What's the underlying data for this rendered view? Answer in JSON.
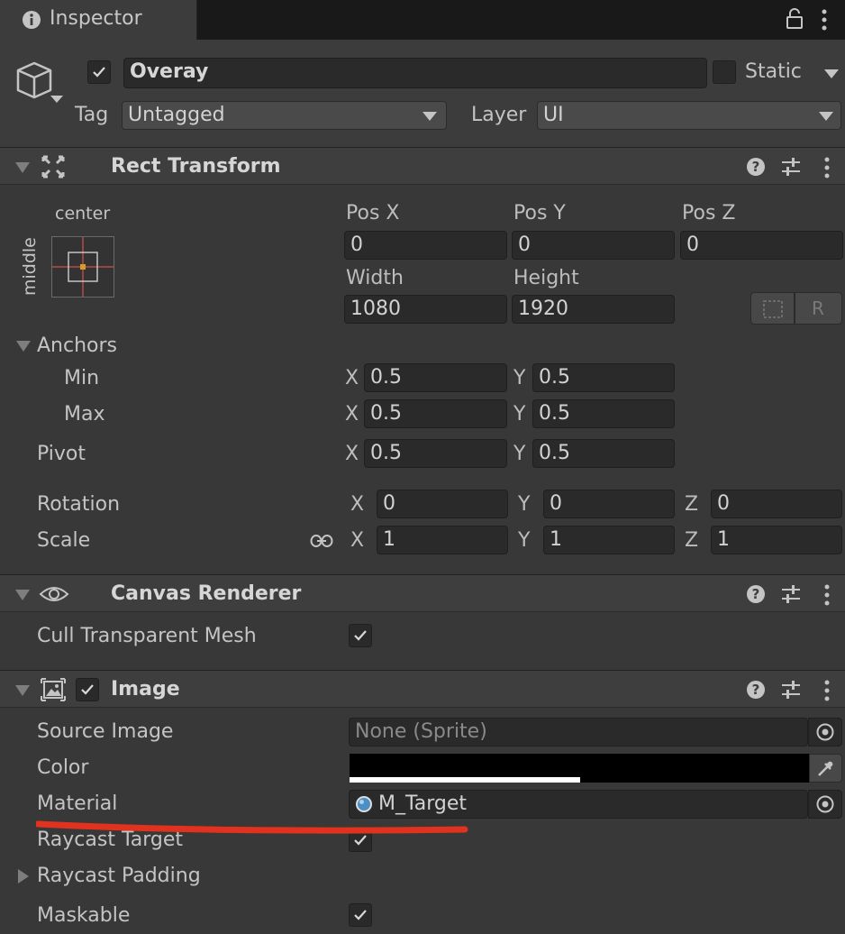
{
  "tab": {
    "title": "Inspector"
  },
  "object": {
    "name": "Overay",
    "active": true,
    "static_label": "Static",
    "tag_label": "Tag",
    "tag_value": "Untagged",
    "layer_label": "Layer",
    "layer_value": "UI"
  },
  "rect_transform": {
    "title": "Rect Transform",
    "anchor_h": "center",
    "anchor_v": "middle",
    "pos_x_label": "Pos X",
    "pos_y_label": "Pos Y",
    "pos_z_label": "Pos Z",
    "pos_x": "0",
    "pos_y": "0",
    "pos_z": "0",
    "width_label": "Width",
    "height_label": "Height",
    "width": "1080",
    "height": "1920",
    "raw_button": "R",
    "anchors_label": "Anchors",
    "min_label": "Min",
    "max_label": "Max",
    "pivot_label": "Pivot",
    "min_x": "0.5",
    "min_y": "0.5",
    "max_x": "0.5",
    "max_y": "0.5",
    "pivot_x": "0.5",
    "pivot_y": "0.5",
    "rotation_label": "Rotation",
    "scale_label": "Scale",
    "rot_x": "0",
    "rot_y": "0",
    "rot_z": "0",
    "scale_x": "1",
    "scale_y": "1",
    "scale_z": "1",
    "axis_x": "X",
    "axis_y": "Y",
    "axis_z": "Z"
  },
  "canvas_renderer": {
    "title": "Canvas Renderer",
    "cull_label": "Cull Transparent Mesh",
    "cull": true
  },
  "image": {
    "title": "Image",
    "enabled": true,
    "source_label": "Source Image",
    "source_value": "None (Sprite)",
    "color_label": "Color",
    "color_value": "#000000",
    "material_label": "Material",
    "material_value": "M_Target",
    "raycast_label": "Raycast Target",
    "raycast": true,
    "padding_label": "Raycast Padding",
    "maskable_label": "Maskable",
    "maskable": true
  },
  "colors": {
    "panel": "#383838",
    "field": "#2a2a2a",
    "header": "#3e3e3e",
    "annotation": "#e0321e"
  }
}
